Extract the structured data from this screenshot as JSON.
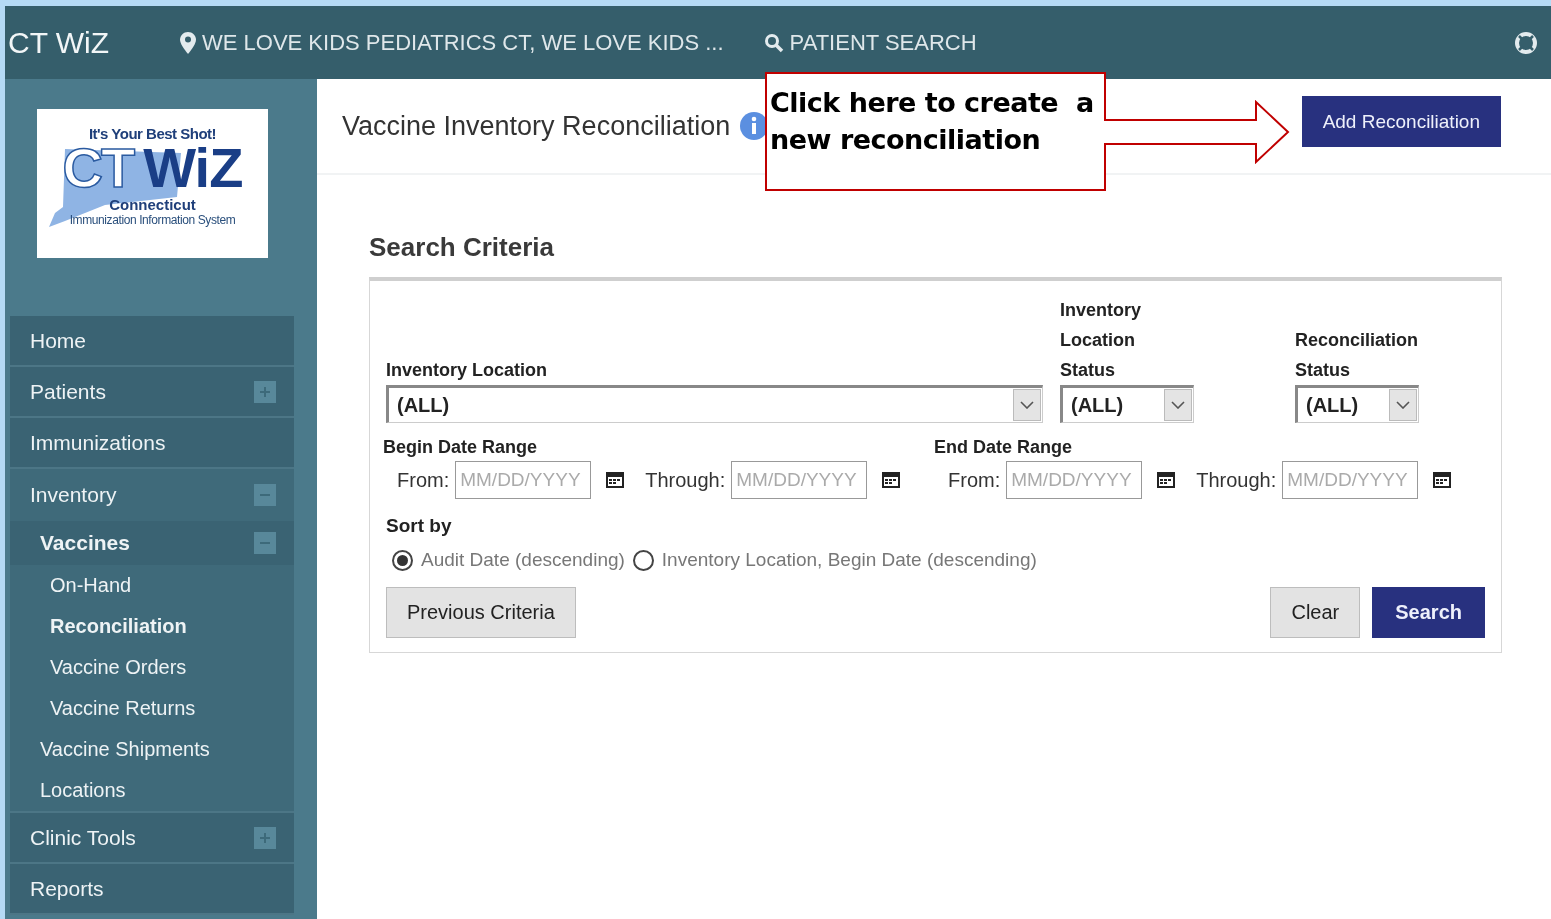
{
  "header": {
    "app_name": "CT WiZ",
    "location": "WE LOVE KIDS PEDIATRICS CT, WE LOVE KIDS ...",
    "patient_search": "PATIENT SEARCH"
  },
  "sidebar": {
    "logo": {
      "tagline": "It's Your Best Shot!",
      "title_left": "CT",
      "title_right": "WiZ",
      "state": "Connecticut",
      "subtitle": "Immunization Information System"
    },
    "items": [
      {
        "label": "Home",
        "selected": false
      },
      {
        "label": "Patients",
        "selected": false,
        "expanded": false
      },
      {
        "label": "Immunizations",
        "selected": false
      },
      {
        "label": "Inventory",
        "selected": false,
        "expanded": true,
        "children": [
          {
            "label": "Vaccines",
            "selected": false,
            "expanded": true,
            "children": [
              {
                "label": "On-Hand",
                "selected": false
              },
              {
                "label": "Reconciliation",
                "selected": true
              },
              {
                "label": "Vaccine Orders",
                "selected": false
              },
              {
                "label": "Vaccine Returns",
                "selected": false
              }
            ]
          },
          {
            "label": "Vaccine Shipments",
            "selected": false
          },
          {
            "label": "Locations",
            "selected": false
          }
        ]
      },
      {
        "label": "Clinic Tools",
        "selected": false,
        "expanded": false
      },
      {
        "label": "Reports",
        "selected": false
      }
    ]
  },
  "page": {
    "title": "Vaccine Inventory Reconciliation",
    "add_button": "Add Reconciliation"
  },
  "callout": {
    "text": "Click here to create  a new reconciliation"
  },
  "search": {
    "title": "Search Criteria",
    "selects": [
      {
        "label": "Inventory Location",
        "value": "(ALL)"
      },
      {
        "label": "Inventory Location Status",
        "value": "(ALL)"
      },
      {
        "label": "Reconciliation Status",
        "value": "(ALL)"
      }
    ],
    "date_ranges": [
      {
        "label": "Begin Date Range",
        "from_label": "From:",
        "from_placeholder": "MM/DD/YYYY",
        "through_label": "Through:",
        "through_placeholder": "MM/DD/YYYY"
      },
      {
        "label": "End Date Range",
        "from_label": "From:",
        "from_placeholder": "MM/DD/YYYY",
        "through_label": "Through:",
        "through_placeholder": "MM/DD/YYYY"
      }
    ],
    "sort_label": "Sort by",
    "sort_options": [
      {
        "label": "Audit Date (descending)",
        "selected": true
      },
      {
        "label": "Inventory Location, Begin Date (descending)",
        "selected": false
      }
    ],
    "buttons": {
      "previous": "Previous Criteria",
      "clear": "Clear",
      "search": "Search"
    }
  }
}
